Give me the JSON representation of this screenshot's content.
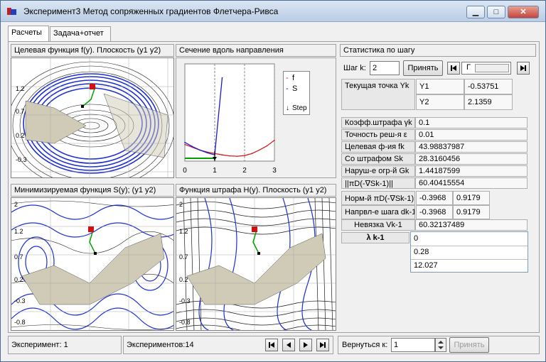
{
  "window": {
    "title": "Эксперимент3 Метод сопряженных градиентов Флетчера-Ривса",
    "minimize": "▁",
    "maximize": "□",
    "close": "✕"
  },
  "tabs": [
    "Расчеты",
    "Задача+отчет"
  ],
  "panels": {
    "objective": "Целевая функция f(y). Плоскость (y1 y2)",
    "section": "Сечение вдоль направления",
    "minimized": "Минимизируемая функция S(y); (y1 y2)",
    "penalty": "Функция штрафа H(y). Плоскость (y1 y2)"
  },
  "contour_ticks": {
    "a": [
      "1.2",
      "0.7",
      "0.2",
      "-0.3"
    ],
    "b": [
      "1.7",
      "1.2",
      "0.7",
      "0.2",
      "-0.3",
      "-0.8"
    ],
    "c": [
      "2",
      "1.2",
      "0.7",
      "0.2",
      "-0.3",
      "-0.8"
    ],
    "d": [
      "2",
      "1.2",
      "0.7",
      "0.2",
      "-0.3",
      "-0.8"
    ]
  },
  "chart_data": {
    "type": "line",
    "x": [
      0,
      0.25,
      0.5,
      0.75,
      1,
      1.25,
      1.5,
      1.75,
      2,
      2.25,
      2.5,
      2.75,
      3
    ],
    "series": [
      {
        "name": "f",
        "values": [
          0.44,
          0.4,
          0.36,
          0.33,
          0.31,
          0.29,
          0.275,
          0.27,
          0.28,
          0.31,
          0.36,
          0.42,
          0.5
        ]
      },
      {
        "name": "S",
        "values": [
          0.47,
          0.41,
          0.36,
          0.32,
          0.29,
          1.4,
          null,
          null,
          null,
          null,
          null,
          null,
          null
        ]
      }
    ],
    "step_marker": 1,
    "xlim": [
      0,
      3
    ],
    "xticks": [
      "0",
      "1",
      "2",
      "3"
    ],
    "legend": [
      "f",
      "S",
      "Step"
    ],
    "legend_position": "top-right",
    "colors": {
      "f": "#d02020",
      "S": "#1a1acc",
      "Step": "#000000"
    }
  },
  "stats": {
    "header": "Статистика по шагу",
    "step_label": "Шаг k:",
    "step_value": "2",
    "accept": "Принять",
    "gamma": "Г",
    "current_point": "Текущая точка Yk",
    "y1_label": "Y1",
    "y1_value": "-0.53751",
    "y2_label": "Y2",
    "y2_value": "2.1359",
    "penalty_coef_label": "Коэфф.штрафа γk",
    "penalty_coef_value": "0.1",
    "accuracy_label": "Точность реш-я  ε",
    "accuracy_value": "0.01",
    "objective_label": "Целевая ф-ия   fk",
    "objective_value": "43.98837987",
    "with_penalty_label": "Со штрафом      Sk",
    "with_penalty_value": "28.3160456",
    "violation_label": "Наруш-е огр-й  Gk",
    "violation_value": "1.44187599",
    "projgrad_label": "||πD(-∇Sk-1)||",
    "projgrad_value": "60.40415554",
    "norm_label": "Норм-й πD(-∇Sk-1)",
    "norm_v1": "-0.3968",
    "norm_v2": "0.9179",
    "direction_label": "Напрвл-е шага dk-1",
    "dir_v1": "-0.3968",
    "dir_v2": "0.9179",
    "residual_label": "Невязка Vk-1",
    "residual_value": "60.32137489",
    "lambda_label": "λ k-1",
    "lambda_values": [
      "0",
      "0.28",
      "12.027"
    ]
  },
  "statusbar": {
    "experiment": "Эксперимент:  1",
    "experiments": "Экспериментов:14",
    "return_label": "Вернуться к:",
    "return_value": "1",
    "accept": "Принять"
  }
}
